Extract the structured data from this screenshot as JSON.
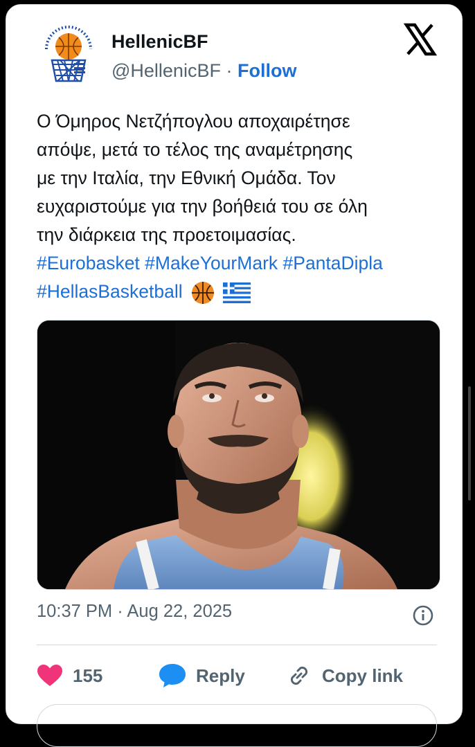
{
  "tweet": {
    "display_name": "HellenicBF",
    "handle": "@HellenicBF",
    "separator": "·",
    "follow_label": "Follow",
    "lines": [
      "Ο Όμηρος Νετζήπογλου αποχαιρέτησε",
      "απόψε, μετά το τέλος της αναμέτρησης",
      "με την Ιταλία, την Εθνική Ομάδα. Τον",
      "ευχαριστούμε για την βοήθειά του σε όλη",
      "την διάρκεια της προετοιμασίας."
    ],
    "hashtags": [
      "#Eurobasket",
      "#MakeYourMark",
      "#PantaDipla",
      "#HellasBasketball"
    ],
    "emojis": [
      "basketball-emoji",
      "greece-flag-emoji"
    ],
    "timestamp": "10:37 PM · Aug 22, 2025"
  },
  "actions": {
    "like_count": "155",
    "reply_label": "Reply",
    "copy_label": "Copy link"
  },
  "colors": {
    "link": "#1d6fd6",
    "text": "#0f1419",
    "muted": "#536471",
    "heart": "#f0347a",
    "reply_bubble": "#1d8ff2"
  }
}
